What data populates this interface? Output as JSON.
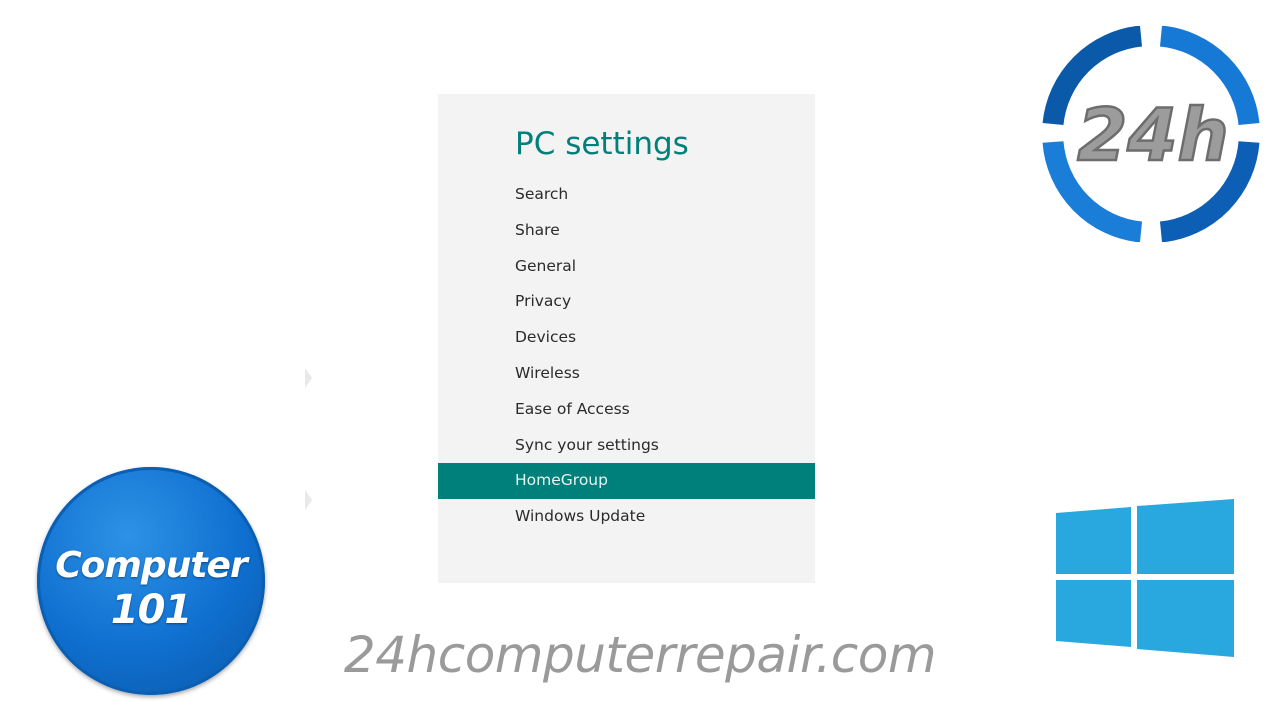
{
  "settings_panel": {
    "title": "PC settings",
    "menu_items": [
      {
        "label": "Search",
        "selected": false
      },
      {
        "label": "Share",
        "selected": false
      },
      {
        "label": "General",
        "selected": false
      },
      {
        "label": "Privacy",
        "selected": false
      },
      {
        "label": "Devices",
        "selected": false
      },
      {
        "label": "Wireless",
        "selected": false
      },
      {
        "label": "Ease of Access",
        "selected": false
      },
      {
        "label": "Sync your settings",
        "selected": false
      },
      {
        "label": "HomeGroup",
        "selected": true
      },
      {
        "label": "Windows Update",
        "selected": false
      }
    ]
  },
  "branding": {
    "logo_24h_text": "24h",
    "badge_line1": "Computer",
    "badge_line2": "101",
    "website": "24hcomputerrepair.com",
    "windows_logo_icon": "windows-logo-icon"
  },
  "colors": {
    "accent_teal": "#00807a",
    "panel_background": "#f3f3f3",
    "logo_blue": "#0a6fcf",
    "windows_blue": "#29a8e0",
    "watermark_gray": "#9a9a9a"
  }
}
